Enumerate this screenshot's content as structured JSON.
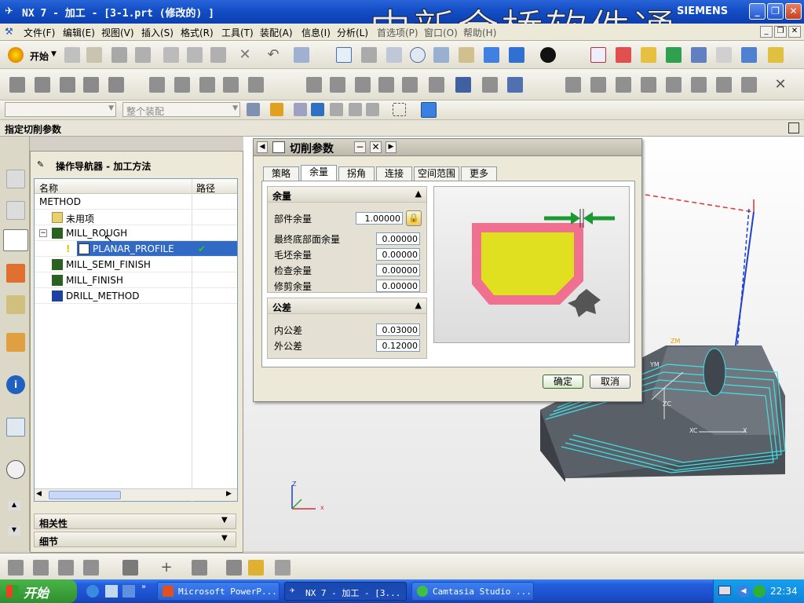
{
  "window": {
    "title": "NX 7 - 加工 - [3-1.prt  (修改的) ]",
    "brand": "SIEMENS",
    "watermark": "中新金桥软件通"
  },
  "menubar": [
    "文件(F)",
    "编辑(E)",
    "视图(V)",
    "插入(S)",
    "格式(R)",
    "工具(T)",
    "装配(A)",
    "信息(I)",
    "分析(L)",
    "首选项(P)",
    "窗口(O)",
    "帮助(H)"
  ],
  "toolbar": {
    "start_label": "开始",
    "filter_placeholder": "整个装配"
  },
  "cue_line": "指定切削参数",
  "navigator": {
    "title": "操作导航器 - 加工方法",
    "col_name": "名称",
    "col_path": "路径",
    "rows": [
      "METHOD",
      "未用项",
      "MILL_ROUGH",
      "PLANAR_PROFILE",
      "MILL_SEMI_FINISH",
      "MILL_FINISH",
      "DRILL_METHOD"
    ],
    "selected_row": "PLANAR_PROFILE",
    "panels": [
      "相关性",
      "细节"
    ]
  },
  "dialog": {
    "title": "切削参数",
    "tabs": [
      "策略",
      "余量",
      "拐角",
      "连接",
      "空间范围",
      "更多"
    ],
    "active_tab": "余量",
    "stock_group": "余量",
    "fields": [
      {
        "label": "部件余量",
        "value": "1.00000"
      },
      {
        "label": "最终底部面余量",
        "value": "0.00000"
      },
      {
        "label": "毛坯余量",
        "value": "0.00000"
      },
      {
        "label": "检查余量",
        "value": "0.00000"
      },
      {
        "label": "修剪余量",
        "value": "0.00000"
      }
    ],
    "tol_group": "公差",
    "tol_fields": [
      {
        "label": "内公差",
        "value": "0.03000"
      },
      {
        "label": "外公差",
        "value": "0.12000"
      }
    ],
    "ok": "确定",
    "cancel": "取消"
  },
  "viewport_labels": {
    "zm": "ZM",
    "ym": "YM",
    "xc": "XC",
    "x": "X",
    "zc": "ZC",
    "z": "Z",
    "xa": "x"
  },
  "taskbar": {
    "start": "开始",
    "tasks": [
      "Microsoft PowerP...",
      "NX 7 - 加工 - [3...",
      "Camtasia Studio ..."
    ],
    "clock": "22:34"
  },
  "colors": {
    "accent": "#316ac5",
    "xp_blue": "#245edb",
    "pink": "#f07090",
    "yellow": "#e0e020",
    "path_cyan": "#40e0e8"
  }
}
